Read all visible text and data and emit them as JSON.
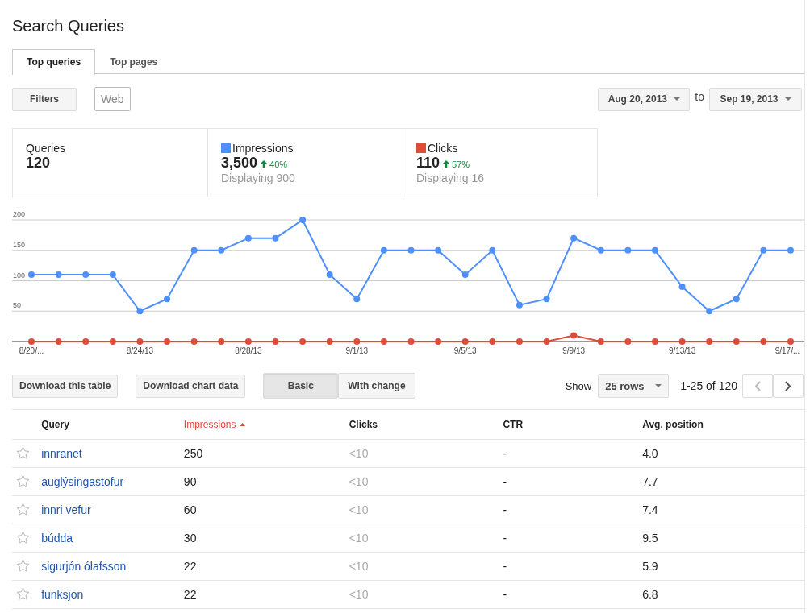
{
  "title": "Search Queries",
  "tabs": [
    {
      "label": "Top queries",
      "selected": true
    },
    {
      "label": "Top pages",
      "selected": false
    }
  ],
  "filters_button": "Filters",
  "filter_chip": "Web",
  "date_range": {
    "start": "Aug 20, 2013",
    "separator": "to",
    "end": "Sep 19, 2013"
  },
  "metrics": [
    {
      "label": "Queries",
      "value": "120"
    },
    {
      "label": "Impressions",
      "color": "#4d90fe",
      "value": "3,500",
      "change": "40%",
      "sub": "Displaying 900"
    },
    {
      "label": "Clicks",
      "color": "#dd4b39",
      "value": "110",
      "change": "57%",
      "sub": "Displaying 16"
    }
  ],
  "chart_data": {
    "type": "line",
    "grid": true,
    "categories": [
      "8/20/...",
      null,
      null,
      null,
      "8/24/13",
      null,
      null,
      null,
      "8/28/13",
      null,
      null,
      null,
      "9/1/13",
      null,
      null,
      null,
      "9/5/13",
      null,
      null,
      null,
      "9/9/13",
      null,
      null,
      null,
      "9/13/13",
      null,
      null,
      null,
      "9/17/..."
    ],
    "yticks": [
      50,
      100,
      150,
      200
    ],
    "ylim": [
      0,
      200
    ],
    "series": [
      {
        "color": "#4d90fe",
        "marker": "circle",
        "values": [
          110,
          110,
          110,
          110,
          50,
          70,
          150,
          150,
          170,
          170,
          200,
          110,
          70,
          150,
          150,
          150,
          110,
          150,
          60,
          70,
          170,
          150,
          150,
          150,
          90,
          50,
          70,
          150,
          150
        ]
      },
      {
        "color": "#dd4b39",
        "marker": "circle",
        "values": [
          0,
          0,
          0,
          0,
          0,
          0,
          0,
          0,
          0,
          0,
          0,
          0,
          0,
          0,
          0,
          0,
          0,
          0,
          0,
          0,
          10,
          0,
          0,
          0,
          0,
          0,
          0,
          0,
          0
        ]
      }
    ]
  },
  "toolbar": {
    "buttons": [
      "Download this table",
      "Download chart data"
    ],
    "views": [
      {
        "label": "Basic",
        "selected": true
      },
      {
        "label": "With change",
        "selected": false
      }
    ],
    "show_label": "Show",
    "rows_select": "25 rows",
    "range": "1-25 of 120"
  },
  "table": {
    "columns": [
      {
        "label": "Query",
        "sorted": false
      },
      {
        "label": "Impressions",
        "sorted": true
      },
      {
        "label": "Clicks",
        "sorted": false
      },
      {
        "label": "CTR",
        "sorted": false
      },
      {
        "label": "Avg. position",
        "sorted": false
      }
    ],
    "rows": [
      {
        "starred": false,
        "cells": [
          "innranet",
          "250",
          "<10",
          "-",
          "4.0"
        ]
      },
      {
        "starred": false,
        "cells": [
          "auglýsingastofur",
          "90",
          "<10",
          "-",
          "7.7"
        ]
      },
      {
        "starred": false,
        "cells": [
          "innri vefur",
          "60",
          "<10",
          "-",
          "7.4"
        ]
      },
      {
        "starred": false,
        "cells": [
          "búdda",
          "30",
          "<10",
          "-",
          "9.5"
        ]
      },
      {
        "starred": false,
        "cells": [
          "sigurjón ólafsson",
          "22",
          "<10",
          "-",
          "5.9"
        ]
      },
      {
        "starred": false,
        "cells": [
          "funksjon",
          "22",
          "<10",
          "-",
          "6.8"
        ]
      }
    ]
  }
}
